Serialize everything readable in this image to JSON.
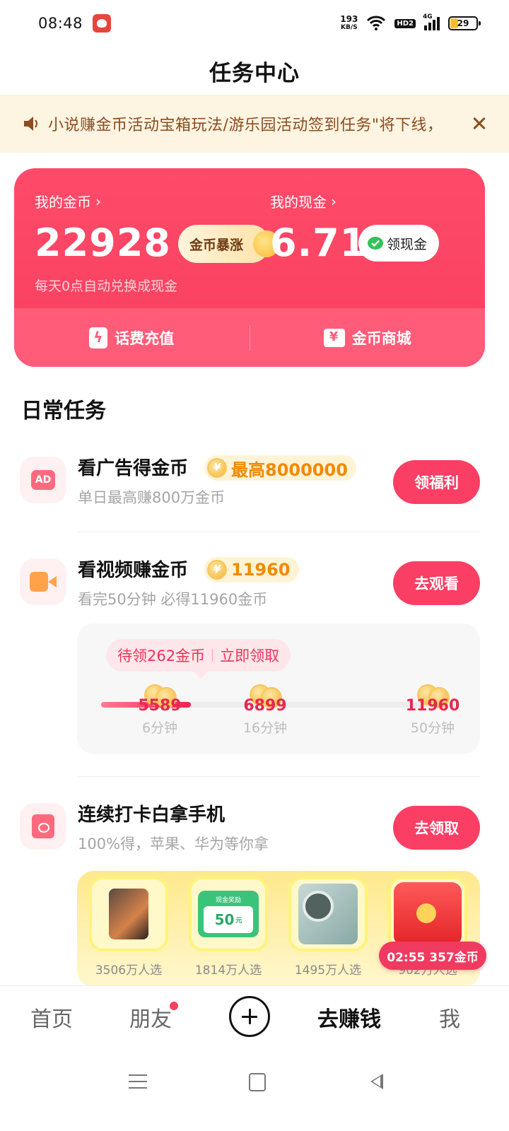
{
  "status_bar": {
    "time": "08:48",
    "net_speed_value": "193",
    "net_speed_unit": "KB/S",
    "hd_label": "HD2",
    "signal_label": "4G",
    "battery": "29"
  },
  "header": {
    "title": "任务中心"
  },
  "notice": {
    "text": "小说赚金币活动宝箱玩法/游乐园活动签到任务\"将下线，"
  },
  "wallet": {
    "coins_label": "我的金币",
    "coins_value": "22928",
    "coins_badge": "金币暴涨",
    "cash_label": "我的现金",
    "cash_value": "6.71",
    "cash_badge": "领现金",
    "subtitle": "每天0点自动兑换成现金",
    "actions": [
      {
        "label": "话费充值",
        "icon": "phone-bill-icon"
      },
      {
        "label": "金币商城",
        "icon": "coin-shop-icon"
      }
    ]
  },
  "daily": {
    "title": "日常任务",
    "tasks": [
      {
        "title": "看广告得金币",
        "icon": "ad-icon",
        "reward": "最高8000000",
        "subtitle": "单日最高赚800万金币",
        "button": "领福利"
      },
      {
        "title": "看视频赚金币",
        "icon": "video-icon",
        "reward": "11960",
        "subtitle": "看完50分钟 必得11960金币",
        "button": "去观看"
      },
      {
        "title": "连续打卡白拿手机",
        "icon": "wallet-icon",
        "subtitle": "100%得，苹果、华为等你拿",
        "button": "去领取"
      }
    ],
    "video_progress": {
      "pending": "待领262金币",
      "claim": "立即领取",
      "progress_fraction": 0.25,
      "milestones": [
        {
          "coins": "5589",
          "time": "6分钟"
        },
        {
          "coins": "6899",
          "time": "16分钟"
        },
        {
          "coins": "11960",
          "time": "50分钟"
        }
      ]
    },
    "prizes": [
      {
        "count": "3506万人选",
        "icon": "iphone-icon"
      },
      {
        "count": "1814万人选",
        "icon": "cash-reward-icon",
        "card_label": "现金奖励",
        "amount": "50",
        "unit": "元"
      },
      {
        "count": "1495万人选",
        "icon": "huawei-phone-icon"
      },
      {
        "count": "902万人选",
        "icon": "red-envelope-box-icon"
      }
    ]
  },
  "floating_timer": "02:55 357金币",
  "bottom_nav": {
    "items": [
      {
        "label": "首页"
      },
      {
        "label": "朋友"
      },
      {
        "label": "去赚钱"
      },
      {
        "label": "我"
      }
    ]
  },
  "colors": {
    "accent": "#fb3e63",
    "wallet_bg": "#ff4a6a",
    "notice_bg": "#fdf4e1",
    "notice_text": "#8a4d1f",
    "reward_text": "#f08a00"
  }
}
